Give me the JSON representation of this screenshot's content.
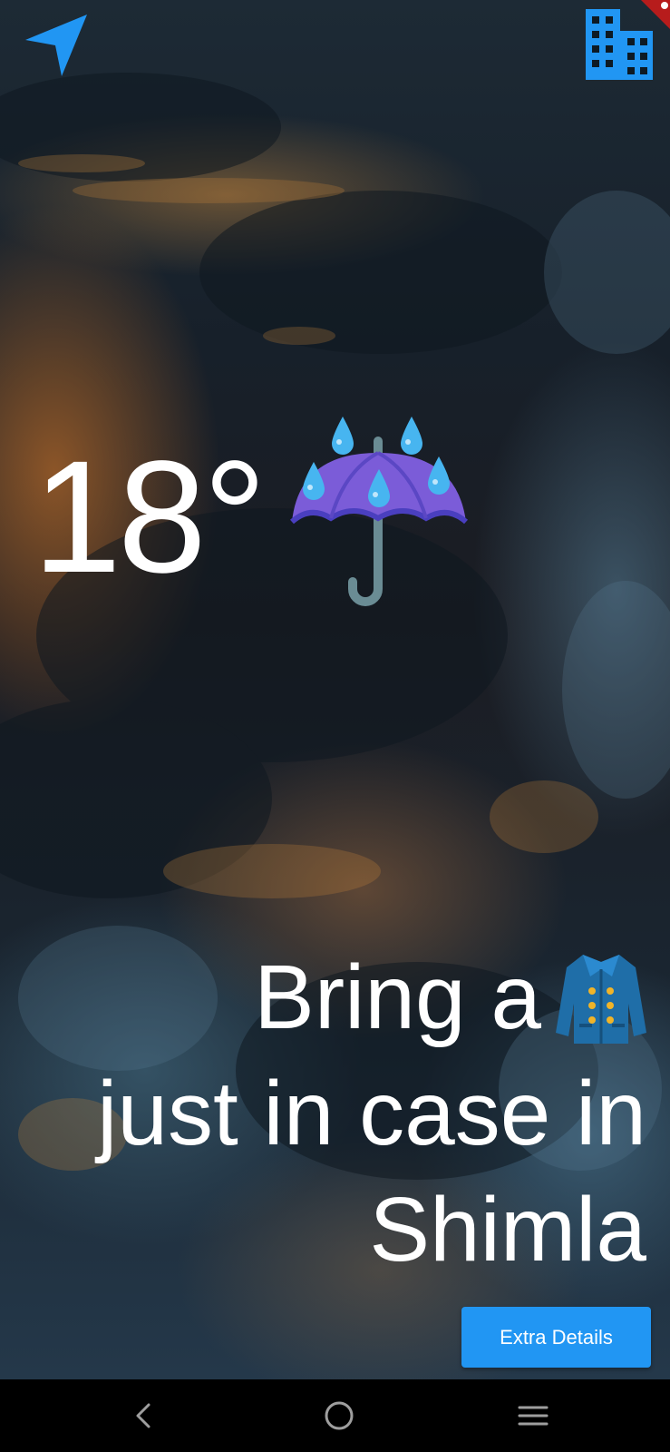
{
  "top_bar": {
    "location_icon": "navigation-arrow-icon",
    "city_icon": "city-buildings-icon"
  },
  "weather": {
    "temperature": "18°",
    "condition_icon": "umbrella-with-rain-drops-icon"
  },
  "message": {
    "line1": "Bring a",
    "line1_icon": "coat-icon",
    "line2": "just in case in",
    "line3": "Shimla"
  },
  "actions": {
    "extra_details_label": "Extra Details"
  },
  "system_nav": {
    "back_icon": "back-chevron-icon",
    "home_icon": "home-circle-icon",
    "menu_icon": "recent-apps-menu-icon"
  },
  "colors": {
    "accent": "#2196f3",
    "text": "#ffffff",
    "nav_bar": "#000000"
  }
}
